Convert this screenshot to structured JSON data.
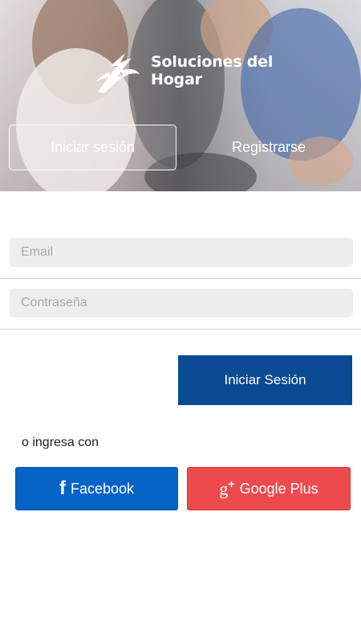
{
  "hero": {
    "brand_line1": "Soluciones del",
    "brand_line2": "Hogar",
    "tabs": [
      {
        "label": "Iniciar sesión"
      },
      {
        "label": "Registrarse"
      }
    ]
  },
  "form": {
    "email_placeholder": "Email",
    "email_value": "",
    "password_placeholder": "Contraseña",
    "password_value": "",
    "submit_label": "Iniciar Sesión"
  },
  "social": {
    "or_label": "o ingresa con",
    "facebook": {
      "label": "Facebook",
      "icon": "facebook-icon",
      "color": "#0563c7"
    },
    "google": {
      "label": "Google Plus",
      "icon": "google-plus-icon",
      "color": "#ec4a4d"
    }
  },
  "colors": {
    "primary": "#0a4a92"
  }
}
